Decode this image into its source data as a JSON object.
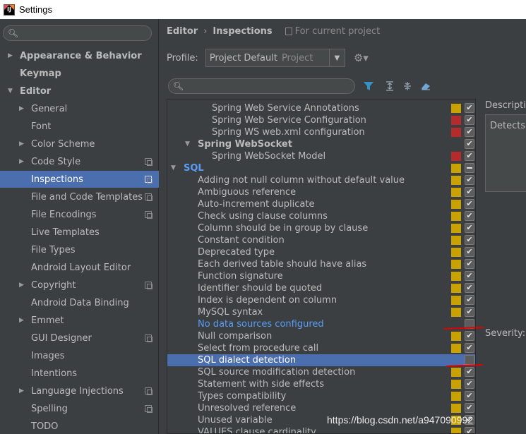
{
  "window": {
    "title": "Settings"
  },
  "sidebar": {
    "items": [
      {
        "label": "Appearance & Behavior",
        "bold": true,
        "arrow": "right",
        "indent": 0
      },
      {
        "label": "Keymap",
        "bold": true,
        "arrow": "",
        "indent": 0
      },
      {
        "label": "Editor",
        "bold": true,
        "arrow": "down",
        "indent": 0
      },
      {
        "label": "General",
        "arrow": "right",
        "indent": 1
      },
      {
        "label": "Font",
        "arrow": "",
        "indent": 1
      },
      {
        "label": "Color Scheme",
        "arrow": "right",
        "indent": 1
      },
      {
        "label": "Code Style",
        "arrow": "right",
        "indent": 1,
        "copy": true
      },
      {
        "label": "Inspections",
        "arrow": "",
        "indent": 1,
        "copy": true,
        "selected": true
      },
      {
        "label": "File and Code Templates",
        "arrow": "",
        "indent": 1,
        "copy": true
      },
      {
        "label": "File Encodings",
        "arrow": "",
        "indent": 1,
        "copy": true
      },
      {
        "label": "Live Templates",
        "arrow": "",
        "indent": 1
      },
      {
        "label": "File Types",
        "arrow": "",
        "indent": 1
      },
      {
        "label": "Android Layout Editor",
        "arrow": "",
        "indent": 1
      },
      {
        "label": "Copyright",
        "arrow": "right",
        "indent": 1,
        "copy": true
      },
      {
        "label": "Android Data Binding",
        "arrow": "",
        "indent": 1
      },
      {
        "label": "Emmet",
        "arrow": "right",
        "indent": 1
      },
      {
        "label": "GUI Designer",
        "arrow": "",
        "indent": 1,
        "copy": true
      },
      {
        "label": "Images",
        "arrow": "",
        "indent": 1
      },
      {
        "label": "Intentions",
        "arrow": "",
        "indent": 1
      },
      {
        "label": "Language Injections",
        "arrow": "right",
        "indent": 1,
        "copy": true
      },
      {
        "label": "Spelling",
        "arrow": "",
        "indent": 1,
        "copy": true
      },
      {
        "label": "TODO",
        "arrow": "",
        "indent": 1
      }
    ]
  },
  "breadcrumb": {
    "editor": "Editor",
    "sep": "›",
    "page": "Inspections",
    "scope": "For current project"
  },
  "profile": {
    "label": "Profile:",
    "value": "Project Default",
    "scope": "Project"
  },
  "inspections": [
    {
      "text": "Spring Web Service Annotations",
      "indent": 2,
      "sev": "#c9a200",
      "check": "check"
    },
    {
      "text": "Spring Web Service Configuration",
      "indent": 2,
      "sev": "#b52b2b",
      "check": "check"
    },
    {
      "text": "Spring WS web.xml configuration",
      "indent": 2,
      "sev": "#b52b2b",
      "check": "check"
    },
    {
      "text": "Spring WebSocket",
      "indent": 1,
      "bold": true,
      "arrow": "down",
      "sev": "",
      "check": "check"
    },
    {
      "text": "Spring WebSocket Model",
      "indent": 2,
      "sev": "#b52b2b",
      "check": "check"
    },
    {
      "text": "SQL",
      "indent": 0,
      "bold": true,
      "arrow": "down",
      "color": "#589df6",
      "sev": "#c9a200",
      "check": "dash"
    },
    {
      "text": "Adding not null column without default value",
      "indent": 1,
      "sev": "#c9a200",
      "check": "check"
    },
    {
      "text": "Ambiguous reference",
      "indent": 1,
      "sev": "#c9a200",
      "check": "check"
    },
    {
      "text": "Auto-increment duplicate",
      "indent": 1,
      "sev": "#c9a200",
      "check": "check"
    },
    {
      "text": "Check using clause columns",
      "indent": 1,
      "sev": "#c9a200",
      "check": "check"
    },
    {
      "text": "Column should be in group by clause",
      "indent": 1,
      "sev": "#c9a200",
      "check": "check"
    },
    {
      "text": "Constant condition",
      "indent": 1,
      "sev": "#c9a200",
      "check": "check"
    },
    {
      "text": "Deprecated type",
      "indent": 1,
      "sev": "#c9a200",
      "check": "check"
    },
    {
      "text": "Each derived table should have alias",
      "indent": 1,
      "sev": "#c9a200",
      "check": "check"
    },
    {
      "text": "Function signature",
      "indent": 1,
      "sev": "#c9a200",
      "check": "check"
    },
    {
      "text": "Identifier should be quoted",
      "indent": 1,
      "sev": "#c9a200",
      "check": "check"
    },
    {
      "text": "Index is dependent on column",
      "indent": 1,
      "sev": "#c9a200",
      "check": "check"
    },
    {
      "text": "MySQL syntax",
      "indent": 1,
      "sev": "#c9a200",
      "check": "check"
    },
    {
      "text": "No data sources configured",
      "indent": 1,
      "color": "#589df6",
      "sev": "",
      "check": "empty"
    },
    {
      "text": "Null comparison",
      "indent": 1,
      "sev": "#c9a200",
      "check": "check"
    },
    {
      "text": "Select from procedure call",
      "indent": 1,
      "sev": "#c9a200",
      "check": "check"
    },
    {
      "text": "SQL dialect detection",
      "indent": 1,
      "selected": true,
      "sev": "",
      "check": "empty"
    },
    {
      "text": "SQL source modification detection",
      "indent": 1,
      "sev": "#c9a200",
      "check": "check"
    },
    {
      "text": "Statement with side effects",
      "indent": 1,
      "sev": "#c9a200",
      "check": "check"
    },
    {
      "text": "Types compatibility",
      "indent": 1,
      "sev": "#c9a200",
      "check": "check"
    },
    {
      "text": "Unresolved reference",
      "indent": 1,
      "sev": "#c9a200",
      "check": "check"
    },
    {
      "text": "Unused variable",
      "indent": 1,
      "sev": "#c9a200",
      "check": "check"
    },
    {
      "text": "VALUES clause cardinality",
      "indent": 1,
      "sev": "#c9a200",
      "check": "check"
    }
  ],
  "description": {
    "header": "Description",
    "text": "Detects t",
    "severity_label": "Severity:"
  },
  "watermark": {
    "text": "https://blog.csdn.net/a947090992"
  },
  "colors": {
    "selection": "#4b6eaf",
    "background": "#3c3f41",
    "warning": "#c9a200",
    "error": "#b52b2b",
    "link": "#589df6"
  }
}
